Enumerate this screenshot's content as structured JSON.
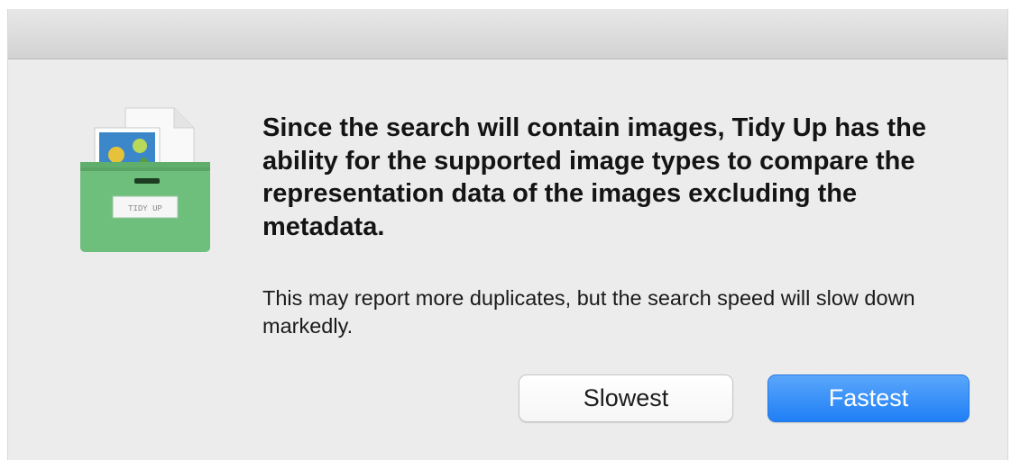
{
  "dialog": {
    "icon_name": "tidy-up-app-icon",
    "icon_label": "TIDY UP",
    "message_heading": "Since the search will contain images, Tidy Up has the ability for the supported image types to compare the representation data of the images excluding the metadata.",
    "message_body": "This may report more duplicates, but the search speed will slow down markedly.",
    "buttons": {
      "secondary_label": "Slowest",
      "primary_label": "Fastest"
    },
    "colors": {
      "background": "#ececec",
      "primary_button": "#2a86f7",
      "icon_box": "#6fbf7c"
    }
  }
}
